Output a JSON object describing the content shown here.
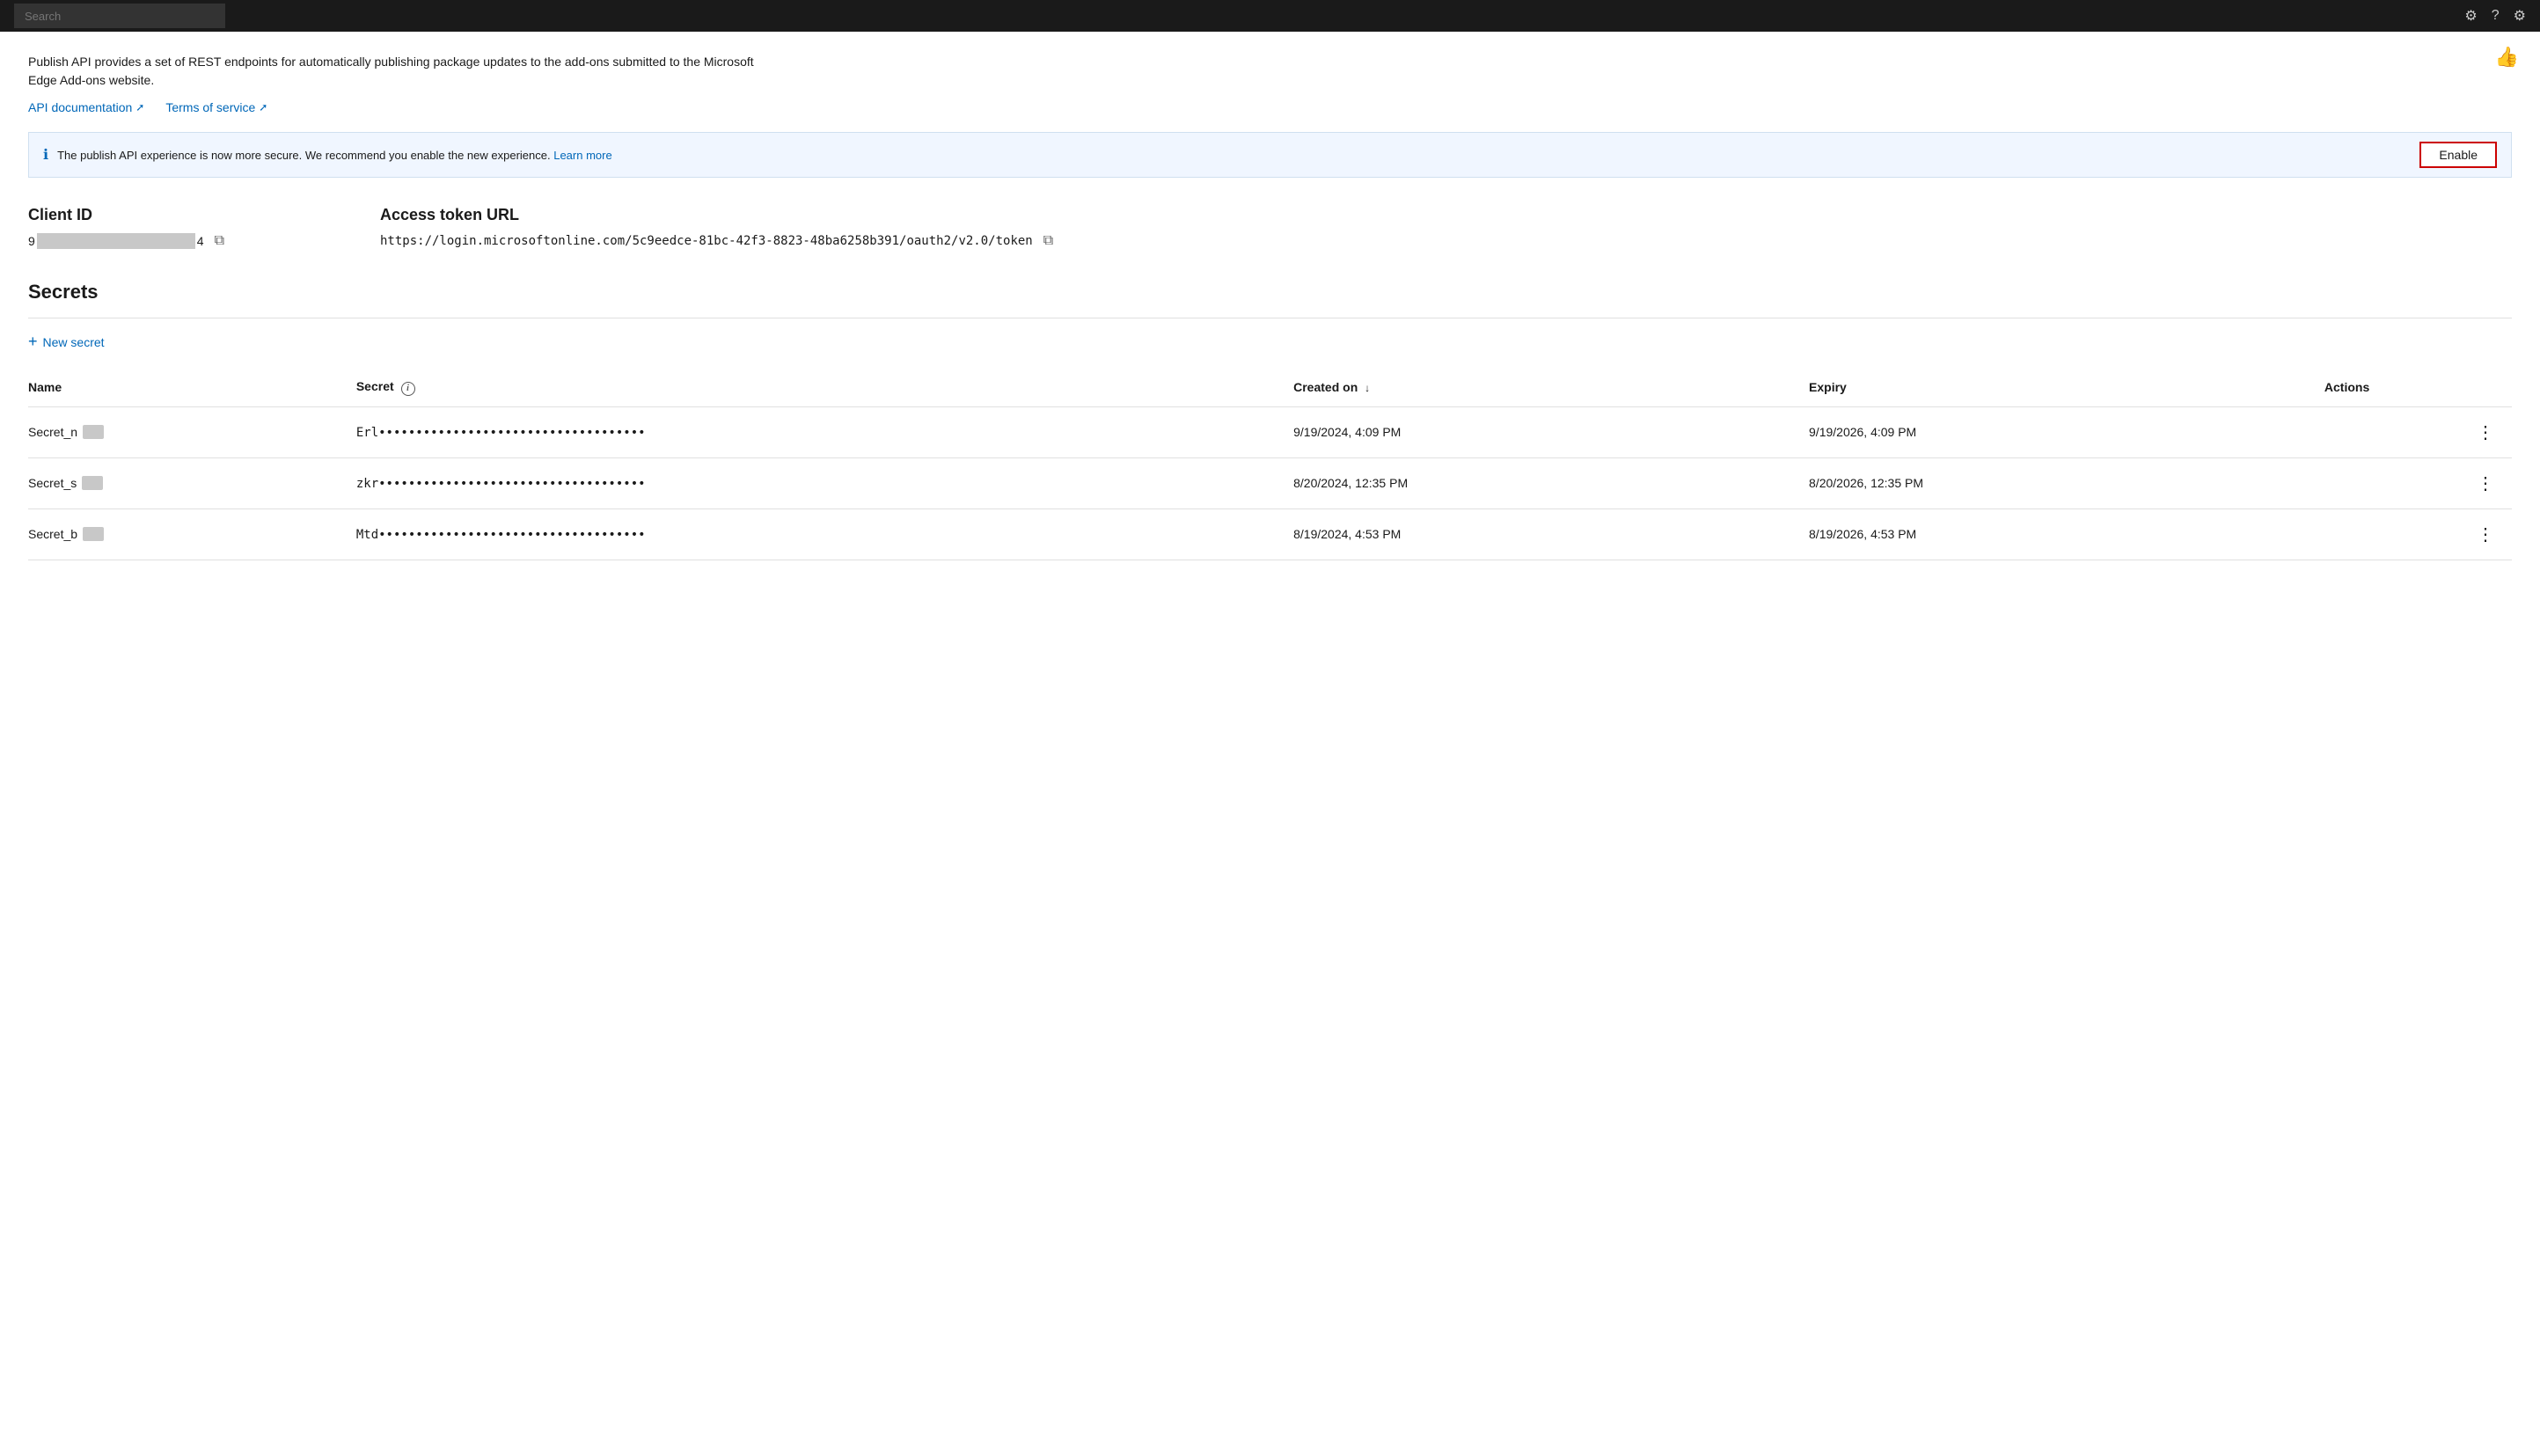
{
  "topbar": {
    "search_placeholder": "Search",
    "icons": [
      "⚙",
      "?",
      "⚙"
    ]
  },
  "thumbs_up_label": "👍",
  "description": {
    "text": "Publish API provides a set of REST endpoints for automatically publishing package updates to the add-ons submitted to the Microsoft Edge Add-ons website."
  },
  "links": [
    {
      "label": "API documentation",
      "icon": "↗"
    },
    {
      "label": "Terms of service",
      "icon": "↗"
    }
  ],
  "banner": {
    "text": "The publish API experience is now more secure. We recommend you enable the new experience.",
    "learn_more": "Learn more",
    "enable_label": "Enable"
  },
  "client_id": {
    "label": "Client ID",
    "prefix": "9",
    "suffix": "4",
    "copy_icon": "⧉"
  },
  "access_token": {
    "label": "Access token URL",
    "value": "https://login.microsoftonline.com/5c9eedce-81bc-42f3-8823-48ba6258b391/oauth2/v2.0/token",
    "copy_icon": "⧉"
  },
  "secrets": {
    "title": "Secrets",
    "new_secret_label": "New secret",
    "columns": {
      "name": "Name",
      "secret": "Secret",
      "created_on": "Created on",
      "sort_arrow": "↓",
      "expiry": "Expiry",
      "actions": "Actions"
    },
    "rows": [
      {
        "name": "Secret_n",
        "name_badge": "",
        "secret_prefix": "Erl",
        "secret_dots": "••••••••••••••••••••••••••••••••••••",
        "created_on": "9/19/2024, 4:09 PM",
        "expiry": "9/19/2026, 4:09 PM"
      },
      {
        "name": "Secret_s",
        "name_badge": "",
        "secret_prefix": "zkr",
        "secret_dots": "••••••••••••••••••••••••••••••••••••",
        "created_on": "8/20/2024, 12:35 PM",
        "expiry": "8/20/2026, 12:35 PM"
      },
      {
        "name": "Secret_b",
        "name_badge": "",
        "secret_prefix": "Mtd",
        "secret_dots": "••••••••••••••••••••••••••••••••••••",
        "created_on": "8/19/2024, 4:53 PM",
        "expiry": "8/19/2026, 4:53 PM"
      }
    ]
  }
}
